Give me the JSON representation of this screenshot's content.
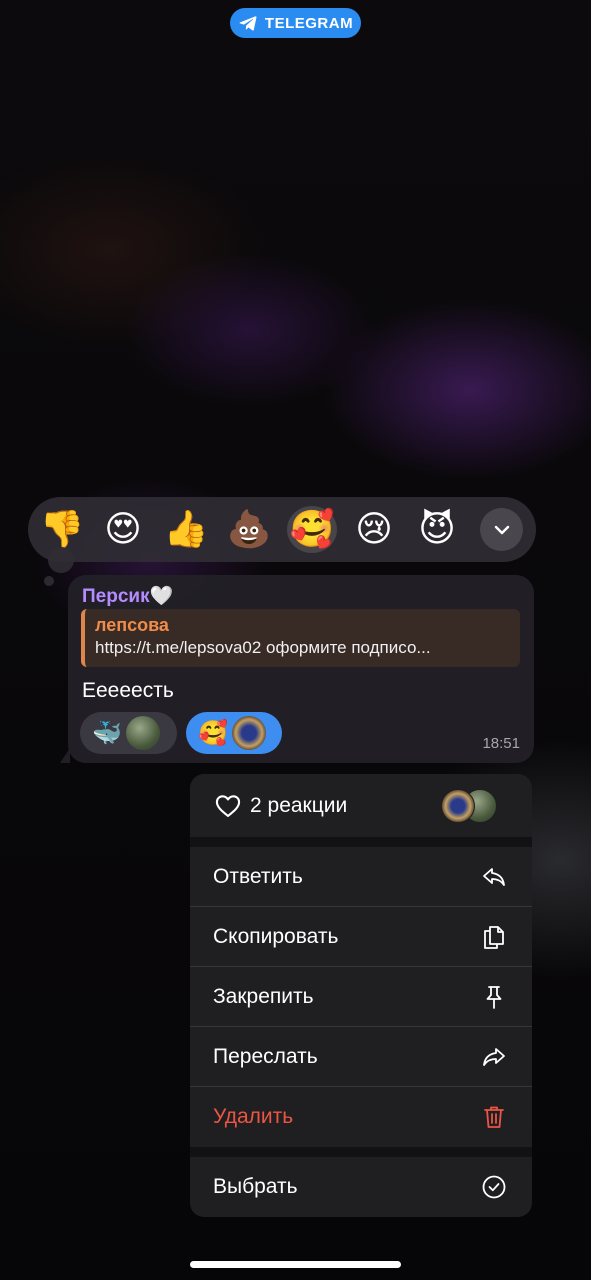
{
  "badge": {
    "label": "TELEGRAM",
    "icon": "telegram-plane-icon"
  },
  "reaction_bar": {
    "emojis": [
      {
        "char": "👎",
        "name": "thumbs-down"
      },
      {
        "char": "😍",
        "name": "heart-eyes"
      },
      {
        "char": "👍",
        "name": "thumbs-up"
      },
      {
        "char": "💩",
        "name": "pile-of-poo"
      },
      {
        "char": "🥰",
        "name": "smiling-face-with-hearts",
        "selected": true
      },
      {
        "char": "😢",
        "name": "crying-face"
      },
      {
        "char": "😈",
        "name": "smiling-devil"
      }
    ],
    "expand_icon": "chevron-down-icon"
  },
  "message": {
    "sender": "Персик🤍",
    "quote": {
      "author": "лепсова",
      "text": "https://t.me/lepsova02 оформите подписо..."
    },
    "text": "Еееeесть",
    "time": "18:51",
    "reactions": [
      {
        "emoji": "🐳",
        "mine": false
      },
      {
        "emoji": "🥰",
        "mine": true
      }
    ]
  },
  "context_menu": {
    "reactions_label": "2 реакции",
    "items": [
      {
        "label": "Ответить",
        "icon": "reply-icon"
      },
      {
        "label": "Скопировать",
        "icon": "copy-icon"
      },
      {
        "label": "Закрепить",
        "icon": "pin-icon"
      },
      {
        "label": "Переслать",
        "icon": "forward-icon"
      },
      {
        "label": "Удалить",
        "icon": "trash-icon",
        "danger": true
      },
      {
        "label": "Выбрать",
        "icon": "checkmark-circle-icon"
      }
    ]
  },
  "colors": {
    "accent": "#2a8cf0",
    "sender": "#b48cff",
    "quote": "#f08c4a",
    "danger": "#eb5545"
  }
}
